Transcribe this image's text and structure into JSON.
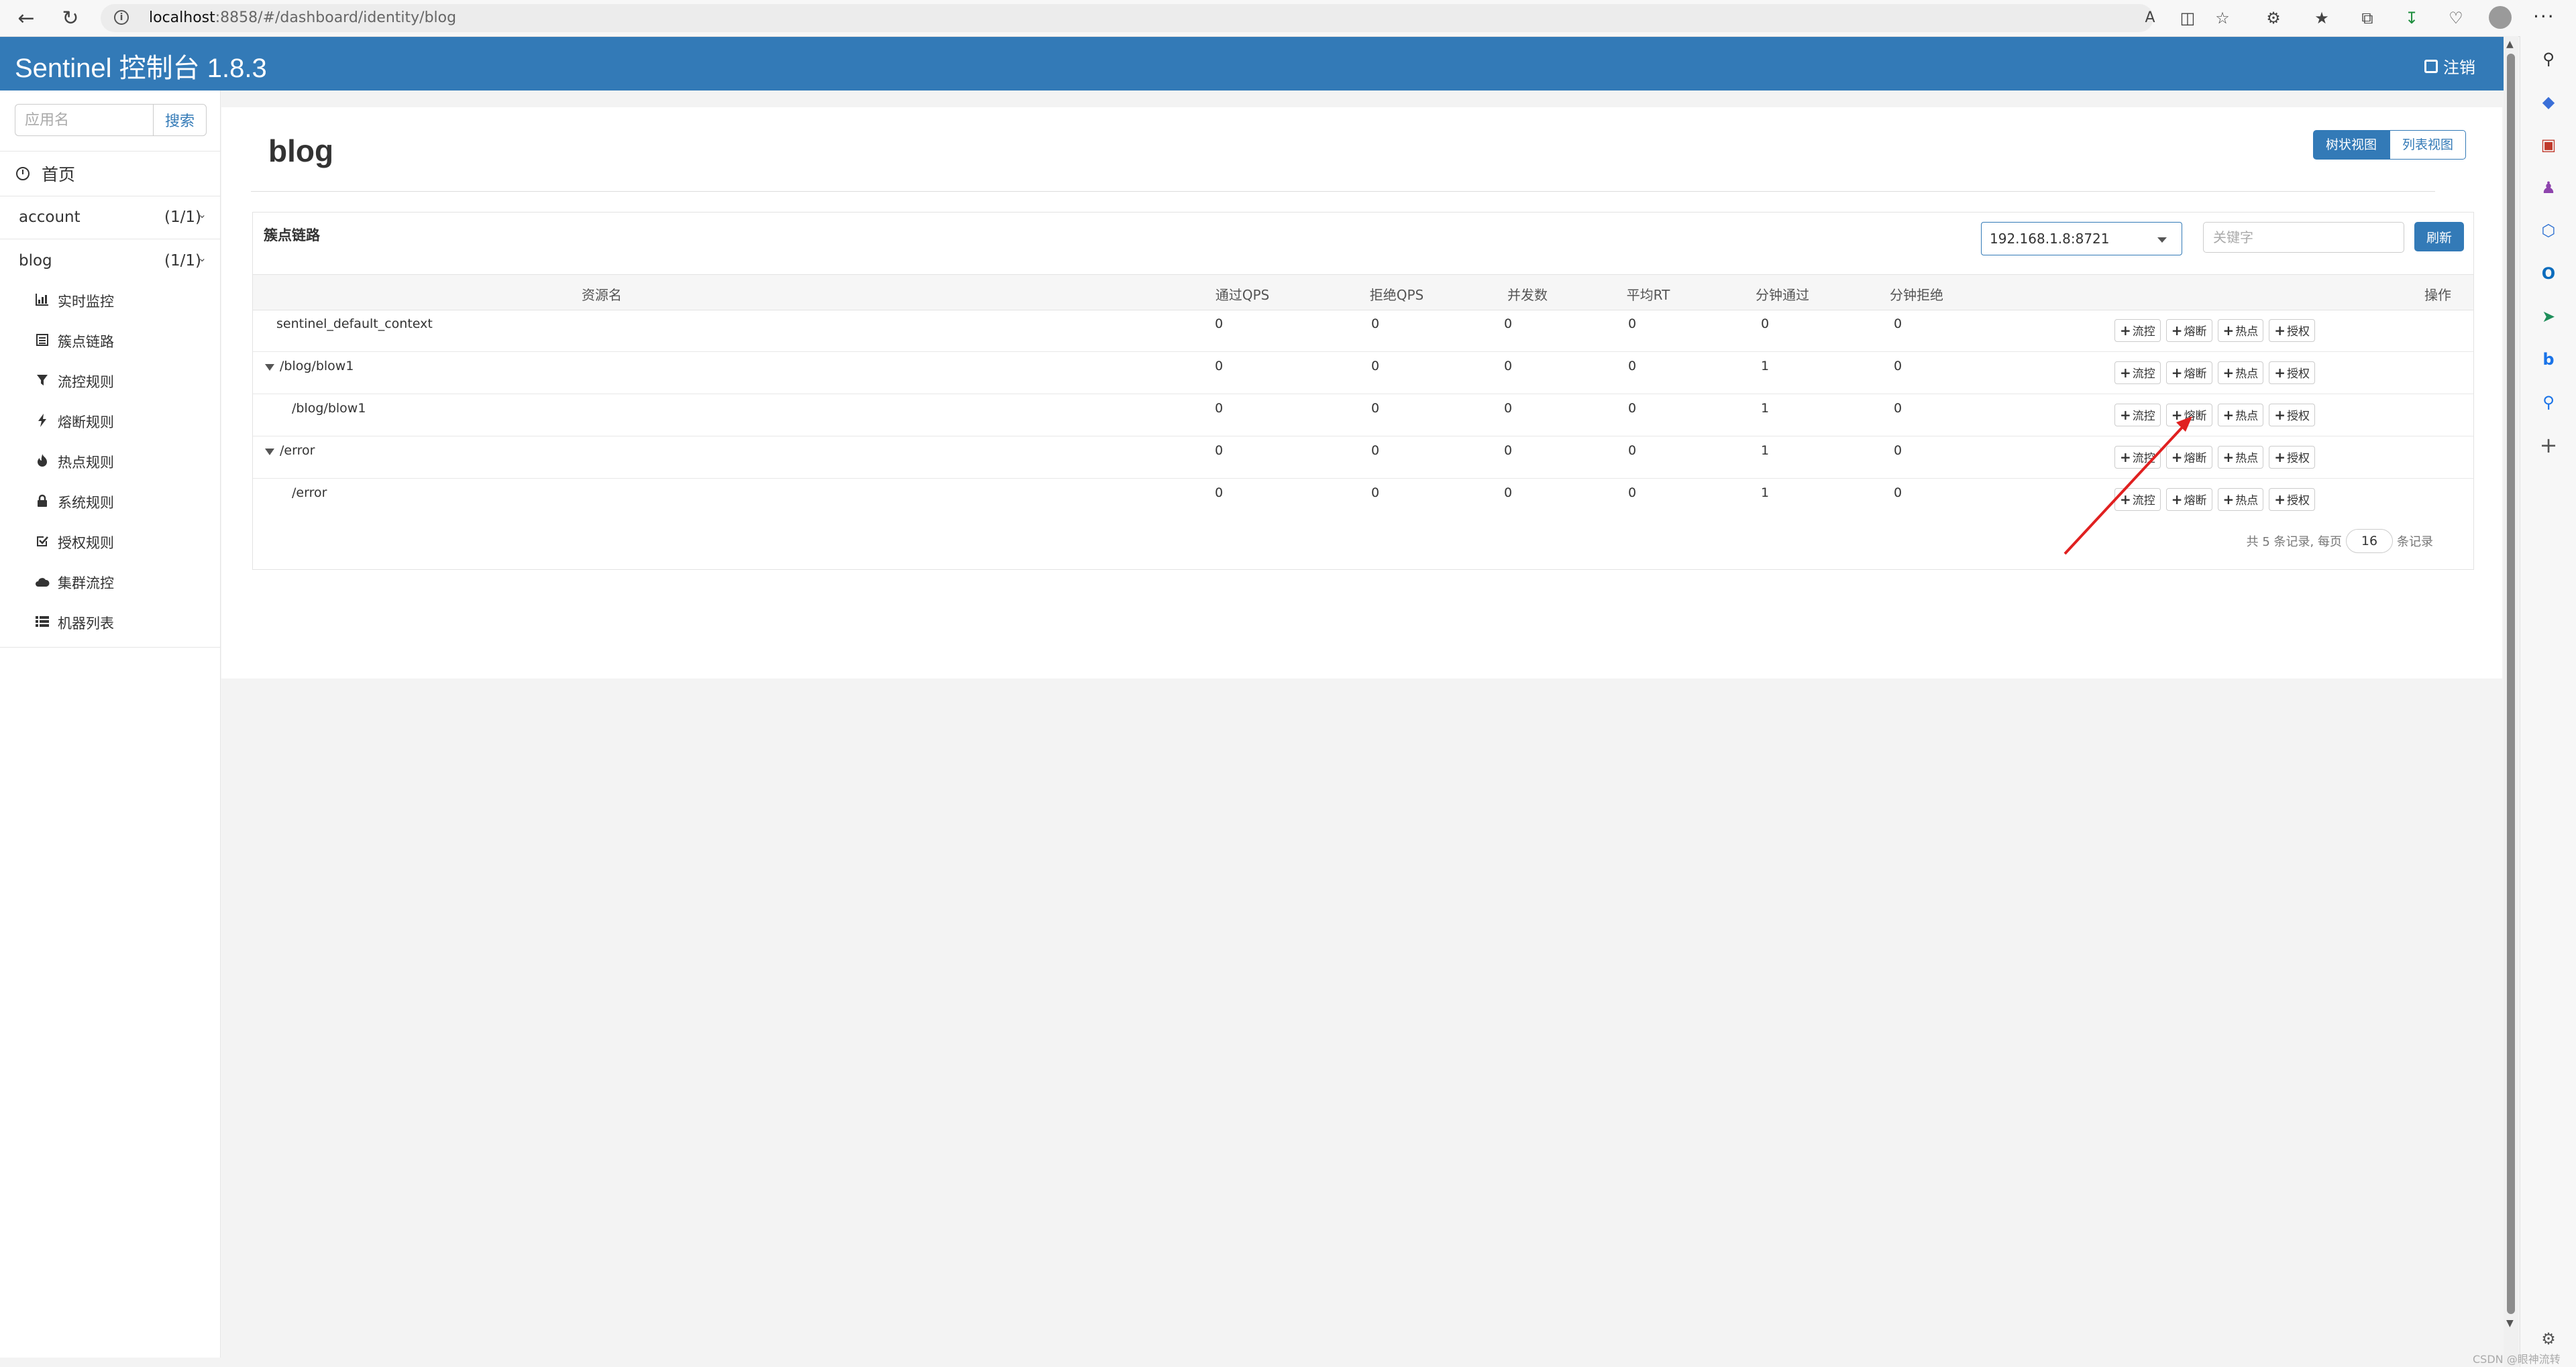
{
  "browser": {
    "url_host": "localhost",
    "url_rest": ":8858/#/dashboard/identity/blog"
  },
  "header": {
    "title": "Sentinel 控制台 1.8.3",
    "logout_label": "注销"
  },
  "sidebar": {
    "search_placeholder": "应用名",
    "search_button": "搜索",
    "home_label": "首页",
    "apps": [
      {
        "name": "account",
        "count": "(1/1)"
      },
      {
        "name": "blog",
        "count": "(1/1)"
      }
    ],
    "menu": [
      {
        "label": "实时监控",
        "icon": "bar-chart-icon"
      },
      {
        "label": "簇点链路",
        "icon": "list-alt-icon"
      },
      {
        "label": "流控规则",
        "icon": "filter-icon"
      },
      {
        "label": "熔断规则",
        "icon": "flash-icon"
      },
      {
        "label": "热点规则",
        "icon": "fire-icon"
      },
      {
        "label": "系统规则",
        "icon": "lock-icon"
      },
      {
        "label": "授权规则",
        "icon": "check-icon"
      },
      {
        "label": "集群流控",
        "icon": "cloud-icon"
      },
      {
        "label": "机器列表",
        "icon": "th-list-icon"
      }
    ]
  },
  "main": {
    "title": "blog",
    "view_tree": "树状视图",
    "view_list": "列表视图",
    "panel_title": "簇点链路",
    "machine": "192.168.1.8:8721",
    "keyword_placeholder": "关键字",
    "refresh": "刷新",
    "columns": [
      "资源名",
      "通过QPS",
      "拒绝QPS",
      "并发数",
      "平均RT",
      "分钟通过",
      "分钟拒绝",
      "操作"
    ],
    "rows": [
      {
        "name": "sentinel_default_context",
        "level": 0,
        "expandable": false,
        "pass_qps": "0",
        "block_qps": "0",
        "threads": "0",
        "avg_rt": "0",
        "min_pass": "0",
        "min_block": "0"
      },
      {
        "name": "/blog/blow1",
        "level": 0,
        "expandable": true,
        "pass_qps": "0",
        "block_qps": "0",
        "threads": "0",
        "avg_rt": "0",
        "min_pass": "1",
        "min_block": "0"
      },
      {
        "name": "/blog/blow1",
        "level": 1,
        "expandable": false,
        "pass_qps": "0",
        "block_qps": "0",
        "threads": "0",
        "avg_rt": "0",
        "min_pass": "1",
        "min_block": "0"
      },
      {
        "name": "/error",
        "level": 0,
        "expandable": true,
        "pass_qps": "0",
        "block_qps": "0",
        "threads": "0",
        "avg_rt": "0",
        "min_pass": "1",
        "min_block": "0"
      },
      {
        "name": "/error",
        "level": 1,
        "expandable": false,
        "pass_qps": "0",
        "block_qps": "0",
        "threads": "0",
        "avg_rt": "0",
        "min_pass": "1",
        "min_block": "0"
      }
    ],
    "ops": [
      "流控",
      "熔断",
      "热点",
      "授权"
    ],
    "pager": {
      "prefix": "共 5 条记录, 每页",
      "page_size": "16",
      "suffix": "条记录"
    }
  },
  "watermark": "CSDN @眼神流转",
  "colors": {
    "primary": "#337ab7",
    "annotation": "#e02020"
  }
}
